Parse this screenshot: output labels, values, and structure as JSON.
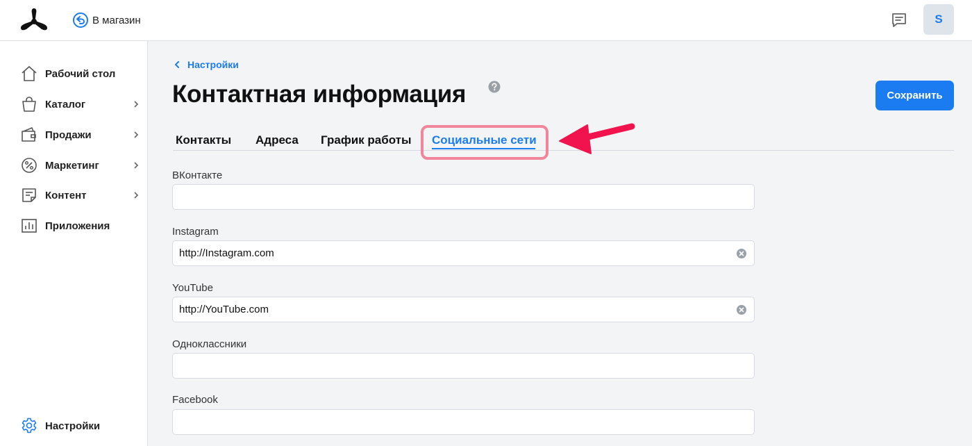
{
  "header": {
    "back_to_store": "В магазин",
    "avatar_letter": "S"
  },
  "sidebar": {
    "items": [
      {
        "label": "Рабочий стол",
        "icon": "home-icon",
        "has_chevron": false
      },
      {
        "label": "Каталог",
        "icon": "bag-icon",
        "has_chevron": true
      },
      {
        "label": "Продажи",
        "icon": "wallet-icon",
        "has_chevron": true
      },
      {
        "label": "Маркетинг",
        "icon": "percent-icon",
        "has_chevron": true
      },
      {
        "label": "Контент",
        "icon": "document-icon",
        "has_chevron": true
      },
      {
        "label": "Приложения",
        "icon": "bar-chart-icon",
        "has_chevron": false
      }
    ],
    "settings_label": "Настройки"
  },
  "main": {
    "breadcrumb": "Настройки",
    "title": "Контактная информация",
    "save_label": "Сохранить",
    "tabs": [
      {
        "label": "Контакты",
        "active": false
      },
      {
        "label": "Адреса",
        "active": false
      },
      {
        "label": "График работы",
        "active": false
      },
      {
        "label": "Социальные сети",
        "active": true
      }
    ],
    "fields": [
      {
        "label": "ВКонтакте",
        "value": ""
      },
      {
        "label": "Instagram",
        "value": "http://Instagram.com"
      },
      {
        "label": "YouTube",
        "value": "http://YouTube.com"
      },
      {
        "label": "Одноклассники",
        "value": ""
      },
      {
        "label": "Facebook",
        "value": ""
      }
    ]
  },
  "colors": {
    "accent": "#1a7cf0",
    "highlight": "#f0859c",
    "annotation_arrow": "#f0134d"
  }
}
